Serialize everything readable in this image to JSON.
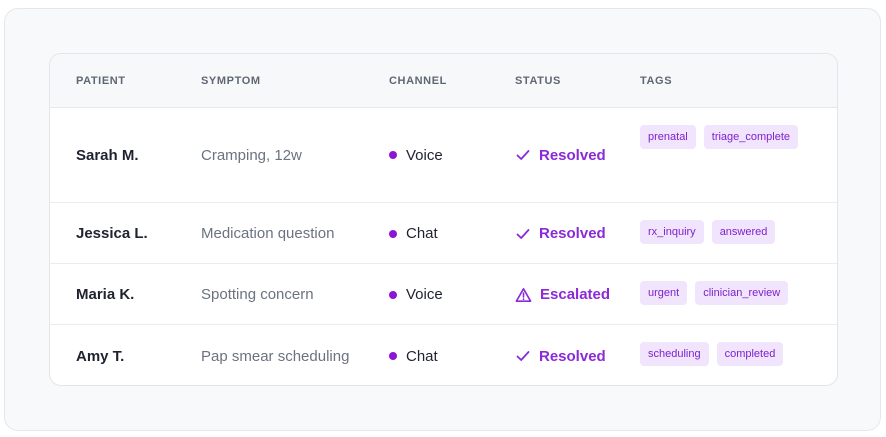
{
  "columns": {
    "patient": "PATIENT",
    "symptom": "SYMPTOM",
    "channel": "CHANNEL",
    "status": "STATUS",
    "tags": "TAGS"
  },
  "rows": [
    {
      "patient": "Sarah M.",
      "symptom": "Cramping, 12w",
      "channel": "Voice",
      "status": "Resolved",
      "status_icon": "check-icon",
      "tags": [
        "prenatal",
        "triage_complete"
      ]
    },
    {
      "patient": "Jessica L.",
      "symptom": "Medication question",
      "channel": "Chat",
      "status": "Resolved",
      "status_icon": "check-icon",
      "tags": [
        "rx_inquiry",
        "answered"
      ]
    },
    {
      "patient": "Maria K.",
      "symptom": "Spotting concern",
      "channel": "Voice",
      "status": "Escalated",
      "status_icon": "warning-icon",
      "tags": [
        "urgent",
        "clinician_review"
      ]
    },
    {
      "patient": "Amy T.",
      "symptom": "Pap smear scheduling",
      "channel": "Chat",
      "status": "Resolved",
      "status_icon": "check-icon",
      "tags": [
        "scheduling",
        "completed"
      ]
    }
  ],
  "colors": {
    "accent": "#8a2ad8",
    "dot": "#8b16d6",
    "tag_bg": "#f1e4fd",
    "tag_text": "#7e22ce"
  }
}
